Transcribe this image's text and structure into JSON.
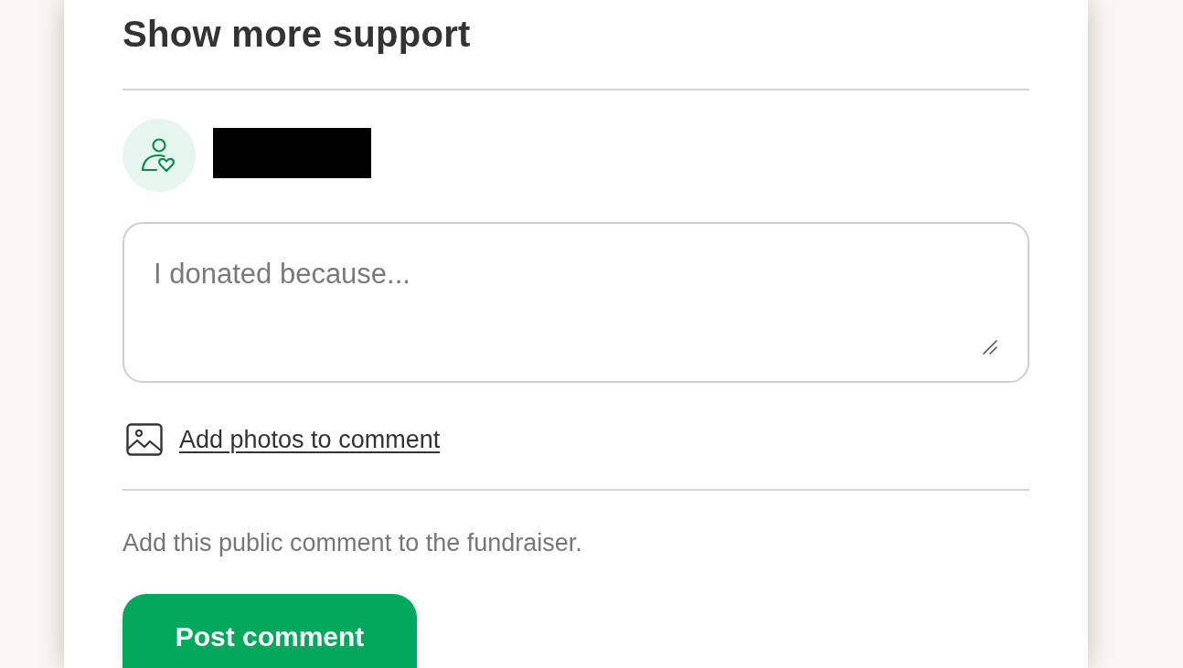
{
  "section": {
    "title": "Show more support"
  },
  "donor": {
    "redacted": true
  },
  "comment_field": {
    "placeholder": "I donated because..."
  },
  "photo_link": {
    "label": "Add photos to comment"
  },
  "note": "Add this public comment to the fundraiser.",
  "submit_button": {
    "label": "Post comment"
  }
}
